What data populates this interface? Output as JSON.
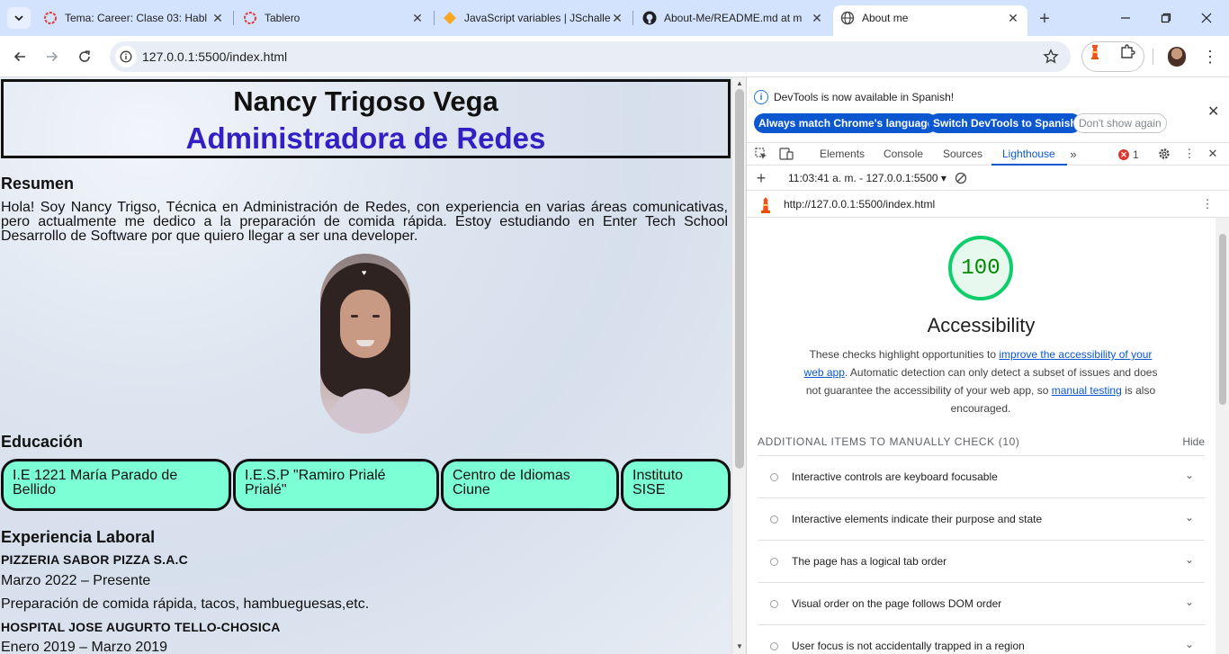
{
  "browser": {
    "tabs": [
      {
        "title": "Tema: Career: Clase 03: Habl",
        "favicon": "red-ring-icon"
      },
      {
        "title": "Tablero",
        "favicon": "red-ring-icon"
      },
      {
        "title": "JavaScript variables | JSchalle",
        "favicon": "orange-diamond-icon"
      },
      {
        "title": "About-Me/README.md at m",
        "favicon": "github-icon"
      },
      {
        "title": "About me",
        "favicon": "globe-icon"
      }
    ],
    "active_tab": 4,
    "url": "127.0.0.1:5500/index.html"
  },
  "page": {
    "name": "Nancy Trigoso Vega",
    "role": "Administradora de Redes",
    "resumen_title": "Resumen",
    "resumen_text": "Hola! Soy Nancy Trigso, Técnica en Administración de Redes, con experiencia en varias áreas comunicativas, pero actualmente me dedico a la preparación de comida rápida. Estoy estudiando en Enter Tech School Desarrollo de Software por que quiero llegar a ser una developer.",
    "educacion_title": "Educación",
    "educacion": [
      "I.E 1221 María Parado de Bellido",
      "I.E.S.P \"Ramiro Prialé Prialé\"",
      "Centro de Idiomas Ciune",
      "Instituto SISE"
    ],
    "experiencia_title": "Experiencia Laboral",
    "jobs": [
      {
        "company": "PIZZERIA SABOR PIZZA S.A.C",
        "period": "Marzo 2022 – Presente",
        "description": "Preparación de comida rápida, tacos, hambueguesas,etc."
      },
      {
        "company": "HOSPITAL JOSE AUGURTO TELLO-CHOSICA",
        "period": "Enero 2019 – Marzo 2019",
        "description": ""
      }
    ],
    "colors": {
      "role": "#3120c4",
      "pill_bg": "#7dffd6"
    }
  },
  "devtools": {
    "banner_text": "DevTools is now available in Spanish!",
    "btn_match": "Always match Chrome's language",
    "btn_switch": "Switch DevTools to Spanish",
    "btn_dont_show": "Don't show again",
    "tabs": [
      "Elements",
      "Console",
      "Sources",
      "Lighthouse"
    ],
    "active_tab": "Lighthouse",
    "error_count": "1",
    "report_time": "11:03:41 a. m. - 127.0.0.1:5500",
    "report_url": "http://127.0.0.1:5500/index.html",
    "score": "100",
    "category": "Accessibility",
    "desc_1": "These checks highlight opportunities to ",
    "desc_link_1": "improve the accessibility of your web app",
    "desc_2": ". Automatic detection can only detect a subset of issues and does not guarantee the accessibility of your web app, so ",
    "desc_link_2": "manual testing",
    "desc_3": " is also encouraged.",
    "manual_header": "ADDITIONAL ITEMS TO MANUALLY CHECK (10)",
    "hide_label": "Hide",
    "audits": [
      "Interactive controls are keyboard focusable",
      "Interactive elements indicate their purpose and state",
      "The page has a logical tab order",
      "Visual order on the page follows DOM order",
      "User focus is not accidentally trapped in a region"
    ],
    "score_color": "#0cce6b"
  }
}
